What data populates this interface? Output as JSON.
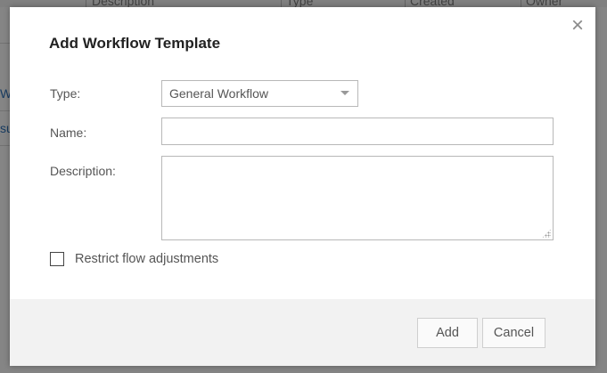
{
  "background": {
    "columns": [
      "Description",
      "Type",
      "Created",
      "Owner"
    ],
    "links": [
      "W",
      "su"
    ]
  },
  "dialog": {
    "title": "Add Workflow Template",
    "close_glyph": "×",
    "type": {
      "label": "Type:",
      "selected": "General Workflow"
    },
    "name": {
      "label": "Name:",
      "value": ""
    },
    "description": {
      "label": "Description:",
      "value": ""
    },
    "restrict": {
      "label": "Restrict flow adjustments",
      "checked": false
    },
    "buttons": {
      "add": "Add",
      "cancel": "Cancel"
    }
  }
}
